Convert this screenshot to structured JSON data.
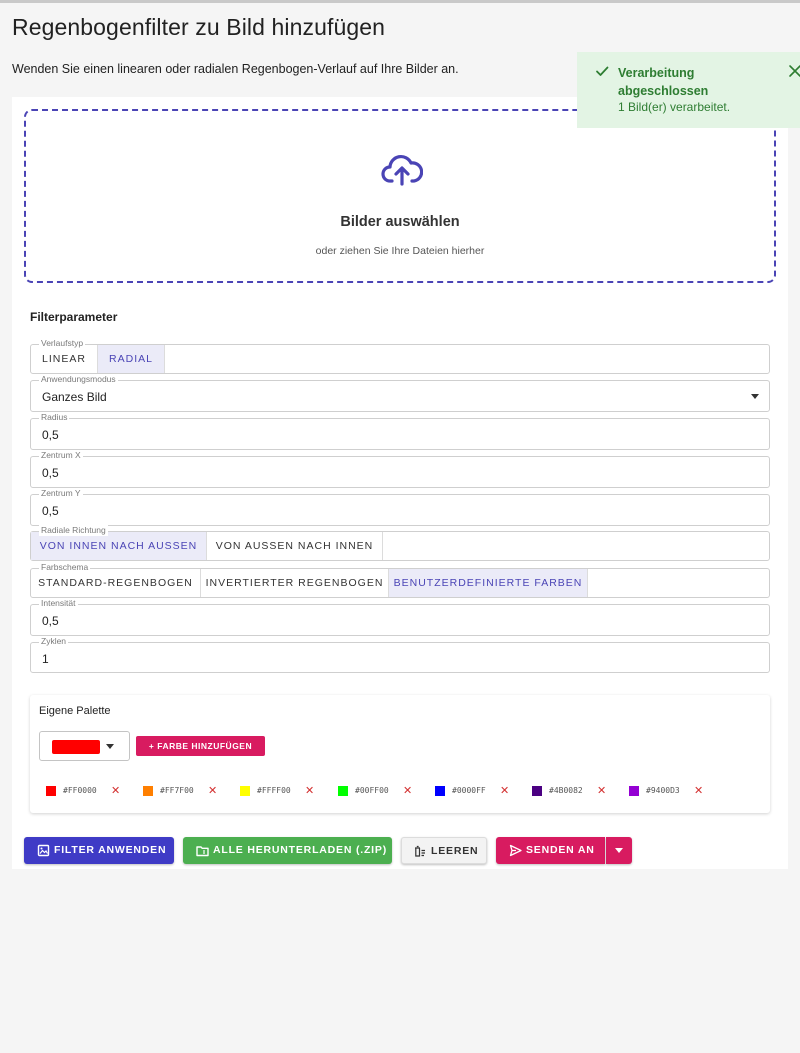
{
  "header": {
    "title": "Regenbogenfilter zu Bild hinzufügen",
    "description": "Wenden Sie einen linearen oder radialen Regenbogen-Verlauf auf Ihre Bilder an."
  },
  "toast": {
    "title": "Verarbeitung abgeschlossen",
    "message": "1 Bild(er) verarbeitet.",
    "icon": "check-icon",
    "close_icon": "close-icon",
    "color": "#2e7d32"
  },
  "dropzone": {
    "icon": "cloud-upload-icon",
    "title": "Bilder auswählen",
    "subtitle": "oder ziehen Sie Ihre Dateien hierher"
  },
  "params": {
    "title": "Filterparameter",
    "gradient_type": {
      "label": "Verlaufstyp",
      "options": [
        "LINEAR",
        "RADIAL"
      ],
      "selected": "RADIAL"
    },
    "apply_mode": {
      "label": "Anwendungsmodus",
      "value": "Ganzes Bild"
    },
    "radius": {
      "label": "Radius",
      "value": "0,5"
    },
    "center_x": {
      "label": "Zentrum X",
      "value": "0,5"
    },
    "center_y": {
      "label": "Zentrum Y",
      "value": "0,5"
    },
    "radial_direction": {
      "label": "Radiale Richtung",
      "options": [
        "VON INNEN NACH AUSSEN",
        "VON AUSSEN NACH INNEN"
      ],
      "selected": "VON INNEN NACH AUSSEN"
    },
    "color_scheme": {
      "label": "Farbschema",
      "options": [
        "STANDARD-REGENBOGEN",
        "INVERTIERTER REGENBOGEN",
        "BENUTZERDEFINIERTE FARBEN"
      ],
      "selected": "BENUTZERDEFINIERTE FARBEN"
    },
    "intensity": {
      "label": "Intensität",
      "value": "0,5"
    },
    "cycles": {
      "label": "Zyklen",
      "value": "1"
    }
  },
  "palette": {
    "title": "Eigene Palette",
    "picker_color": "#ff0000",
    "add_label": "FARBE HINZUFÜGEN",
    "colors": [
      "#FF0000",
      "#FF7F00",
      "#FFFF00",
      "#00FF00",
      "#0000FF",
      "#4B0082",
      "#9400D3"
    ]
  },
  "actions": {
    "apply": "FILTER ANWENDEN",
    "download_all": "ALLE HERUNTERLADEN (.ZIP)",
    "clear": "LEEREN",
    "send_to": "SENDEN AN"
  },
  "colors": {
    "accent": "#4a44b5",
    "apply_bg": "#3f3bc6",
    "download_bg": "#4caf50",
    "send_bg": "#d81b60",
    "toast_bg": "#e3f4e4"
  }
}
